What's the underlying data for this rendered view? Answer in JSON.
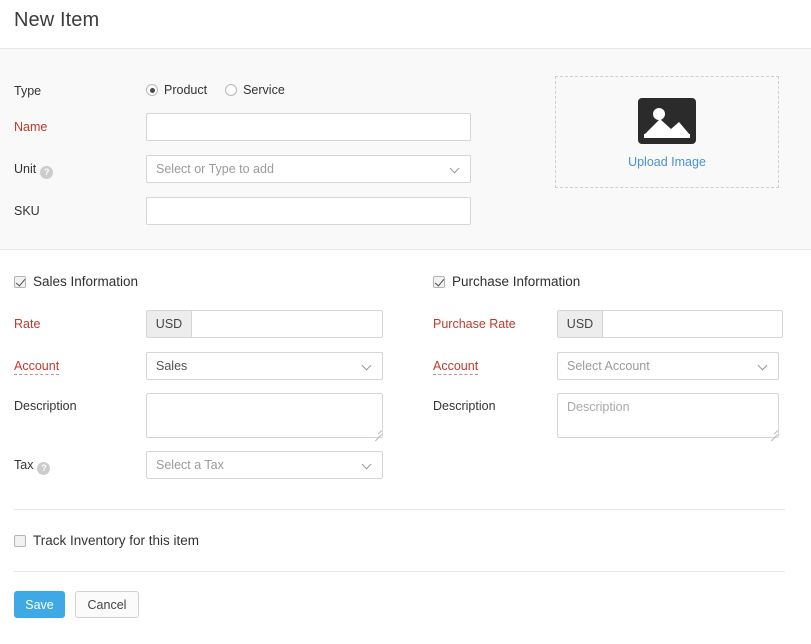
{
  "header": {
    "title": "New Item"
  },
  "top": {
    "type": {
      "label": "Type",
      "options": [
        {
          "label": "Product",
          "selected": true
        },
        {
          "label": "Service",
          "selected": false
        }
      ]
    },
    "name": {
      "label": "Name",
      "value": "",
      "placeholder": ""
    },
    "unit": {
      "label": "Unit",
      "help": "?",
      "value": "Select or Type to add"
    },
    "sku": {
      "label": "SKU",
      "value": "",
      "placeholder": ""
    },
    "upload": {
      "icon": "image-icon",
      "link_label": "Upload Image"
    }
  },
  "sales": {
    "section_label": "Sales Information",
    "section_checked": true,
    "rate": {
      "label": "Rate",
      "currency": "USD",
      "value": "",
      "placeholder": ""
    },
    "account": {
      "label": "Account",
      "value": "Sales"
    },
    "description": {
      "label": "Description",
      "value": "",
      "placeholder": ""
    },
    "tax": {
      "label": "Tax",
      "help": "?",
      "value": "Select a Tax"
    }
  },
  "purchase": {
    "section_label": "Purchase Information",
    "section_checked": true,
    "rate": {
      "label": "Purchase Rate",
      "currency": "USD",
      "value": "",
      "placeholder": ""
    },
    "account": {
      "label": "Account",
      "value": "Select Account"
    },
    "description": {
      "label": "Description",
      "value": "",
      "placeholder": "Description"
    }
  },
  "inventory": {
    "label": "Track Inventory for this item",
    "checked": false
  },
  "actions": {
    "save_label": "Save",
    "cancel_label": "Cancel"
  },
  "colors": {
    "primary": "#3fa9e5",
    "required": "#c0392b",
    "link": "#4a90d9",
    "section_bg": "#f9f9f9",
    "border": "#d6d6d6"
  }
}
